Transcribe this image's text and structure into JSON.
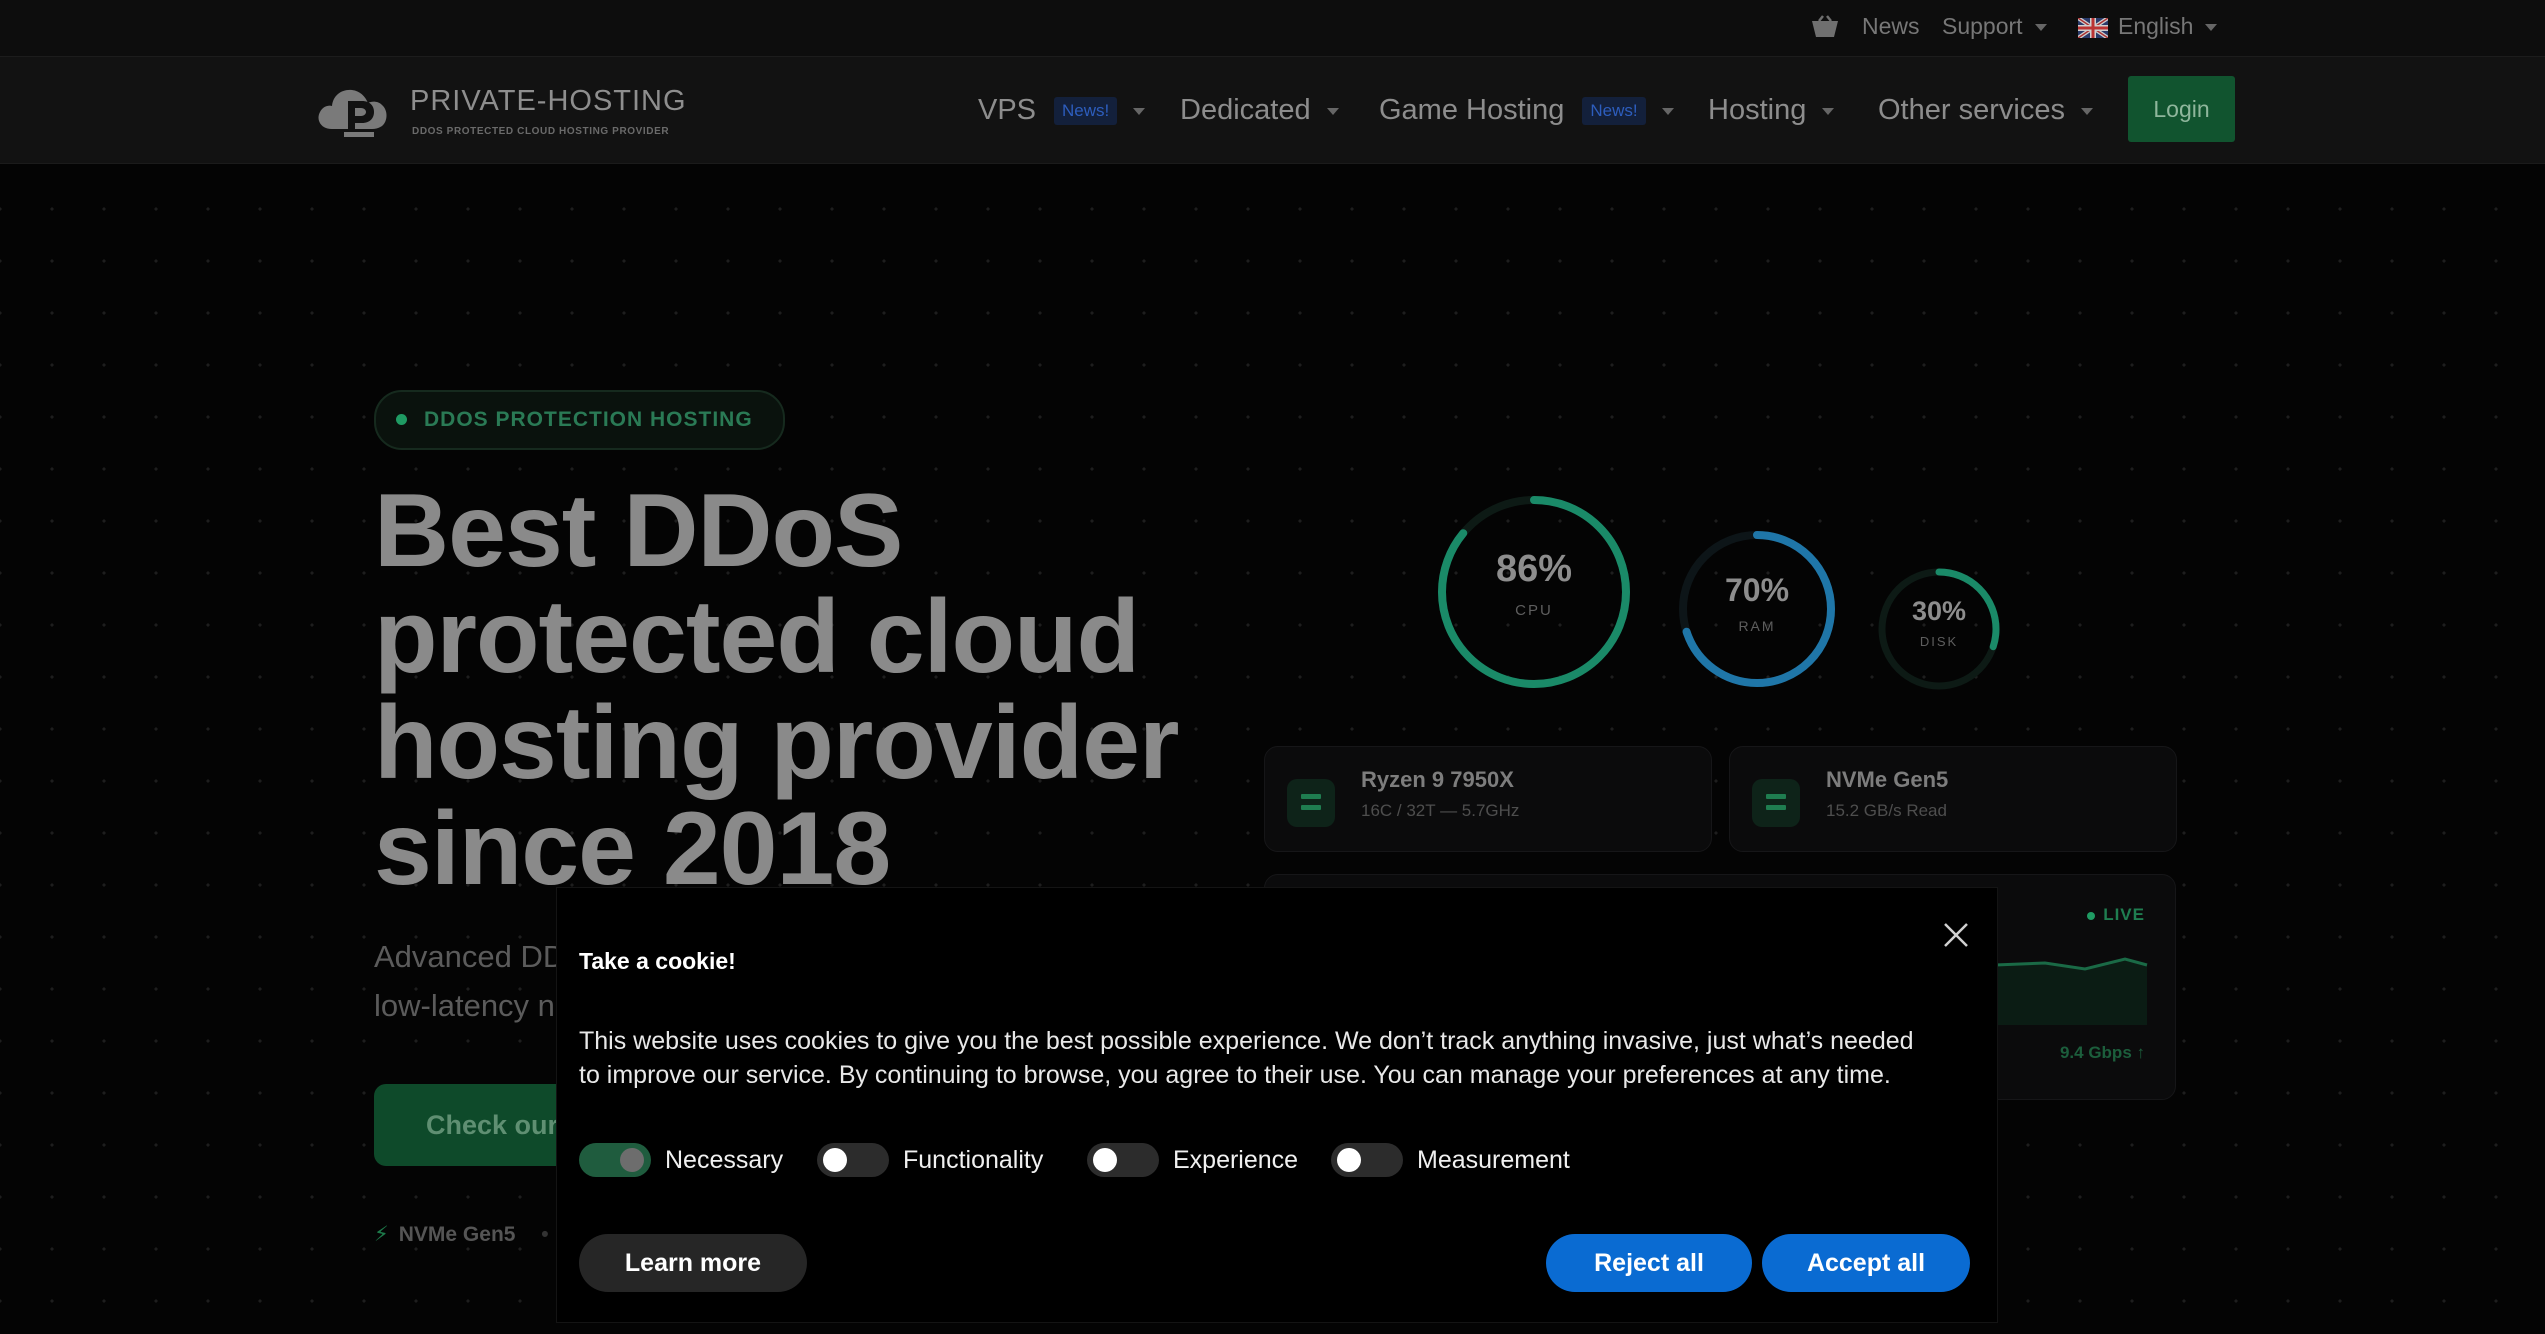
{
  "utility_bar": {
    "news": "News",
    "support": "Support",
    "language": "English"
  },
  "header": {
    "logo_name": "PRIVATE-HOSTING",
    "logo_tagline": "DDOS PROTECTED CLOUD HOSTING PROVIDER",
    "nav": [
      {
        "label": "VPS",
        "badge": "News!"
      },
      {
        "label": "Dedicated"
      },
      {
        "label": "Game Hosting",
        "badge": "News!"
      },
      {
        "label": "Hosting"
      },
      {
        "label": "Other services"
      }
    ],
    "login": "Login"
  },
  "hero": {
    "badge": "DDOS PROTECTION HOSTING",
    "title_lines": [
      "Best DDoS",
      "protected cloud",
      "hosting provider",
      "since 2018"
    ],
    "subtitle_line1": "Advanced DD",
    "subtitle_line2": "low-latency n",
    "cta": "Check our",
    "feature": "NVMe Gen5"
  },
  "gauges": [
    {
      "value": "86%",
      "label": "CPU",
      "fraction": 0.86,
      "color": "#1a8a68"
    },
    {
      "value": "70%",
      "label": "RAM",
      "fraction": 0.7,
      "color": "#1f76a8"
    },
    {
      "value": "30%",
      "label": "DISK",
      "fraction": 0.3,
      "color": "#1a8a68"
    }
  ],
  "specs": [
    {
      "title": "Ryzen 9 7950X",
      "sub": "16C / 32T — 5.7GHz"
    },
    {
      "title": "NVMe Gen5",
      "sub": "15.2 GB/s Read"
    }
  ],
  "traffic": {
    "live": "LIVE",
    "speed": "9.4 Gbps ↑"
  },
  "cookie": {
    "title": "Take a cookie!",
    "text_line1": "This website uses cookies to give you the best possible experience. We don’t track anything invasive, just what’s needed",
    "text_line2": "to improve our service. By continuing to browse, you agree to their use. You can manage your preferences at any time.",
    "toggles": [
      {
        "label": "Necessary",
        "on": true
      },
      {
        "label": "Functionality",
        "on": false
      },
      {
        "label": "Experience",
        "on": false
      },
      {
        "label": "Measurement",
        "on": false
      }
    ],
    "learn_more": "Learn more",
    "reject_all": "Reject all",
    "accept_all": "Accept all"
  }
}
